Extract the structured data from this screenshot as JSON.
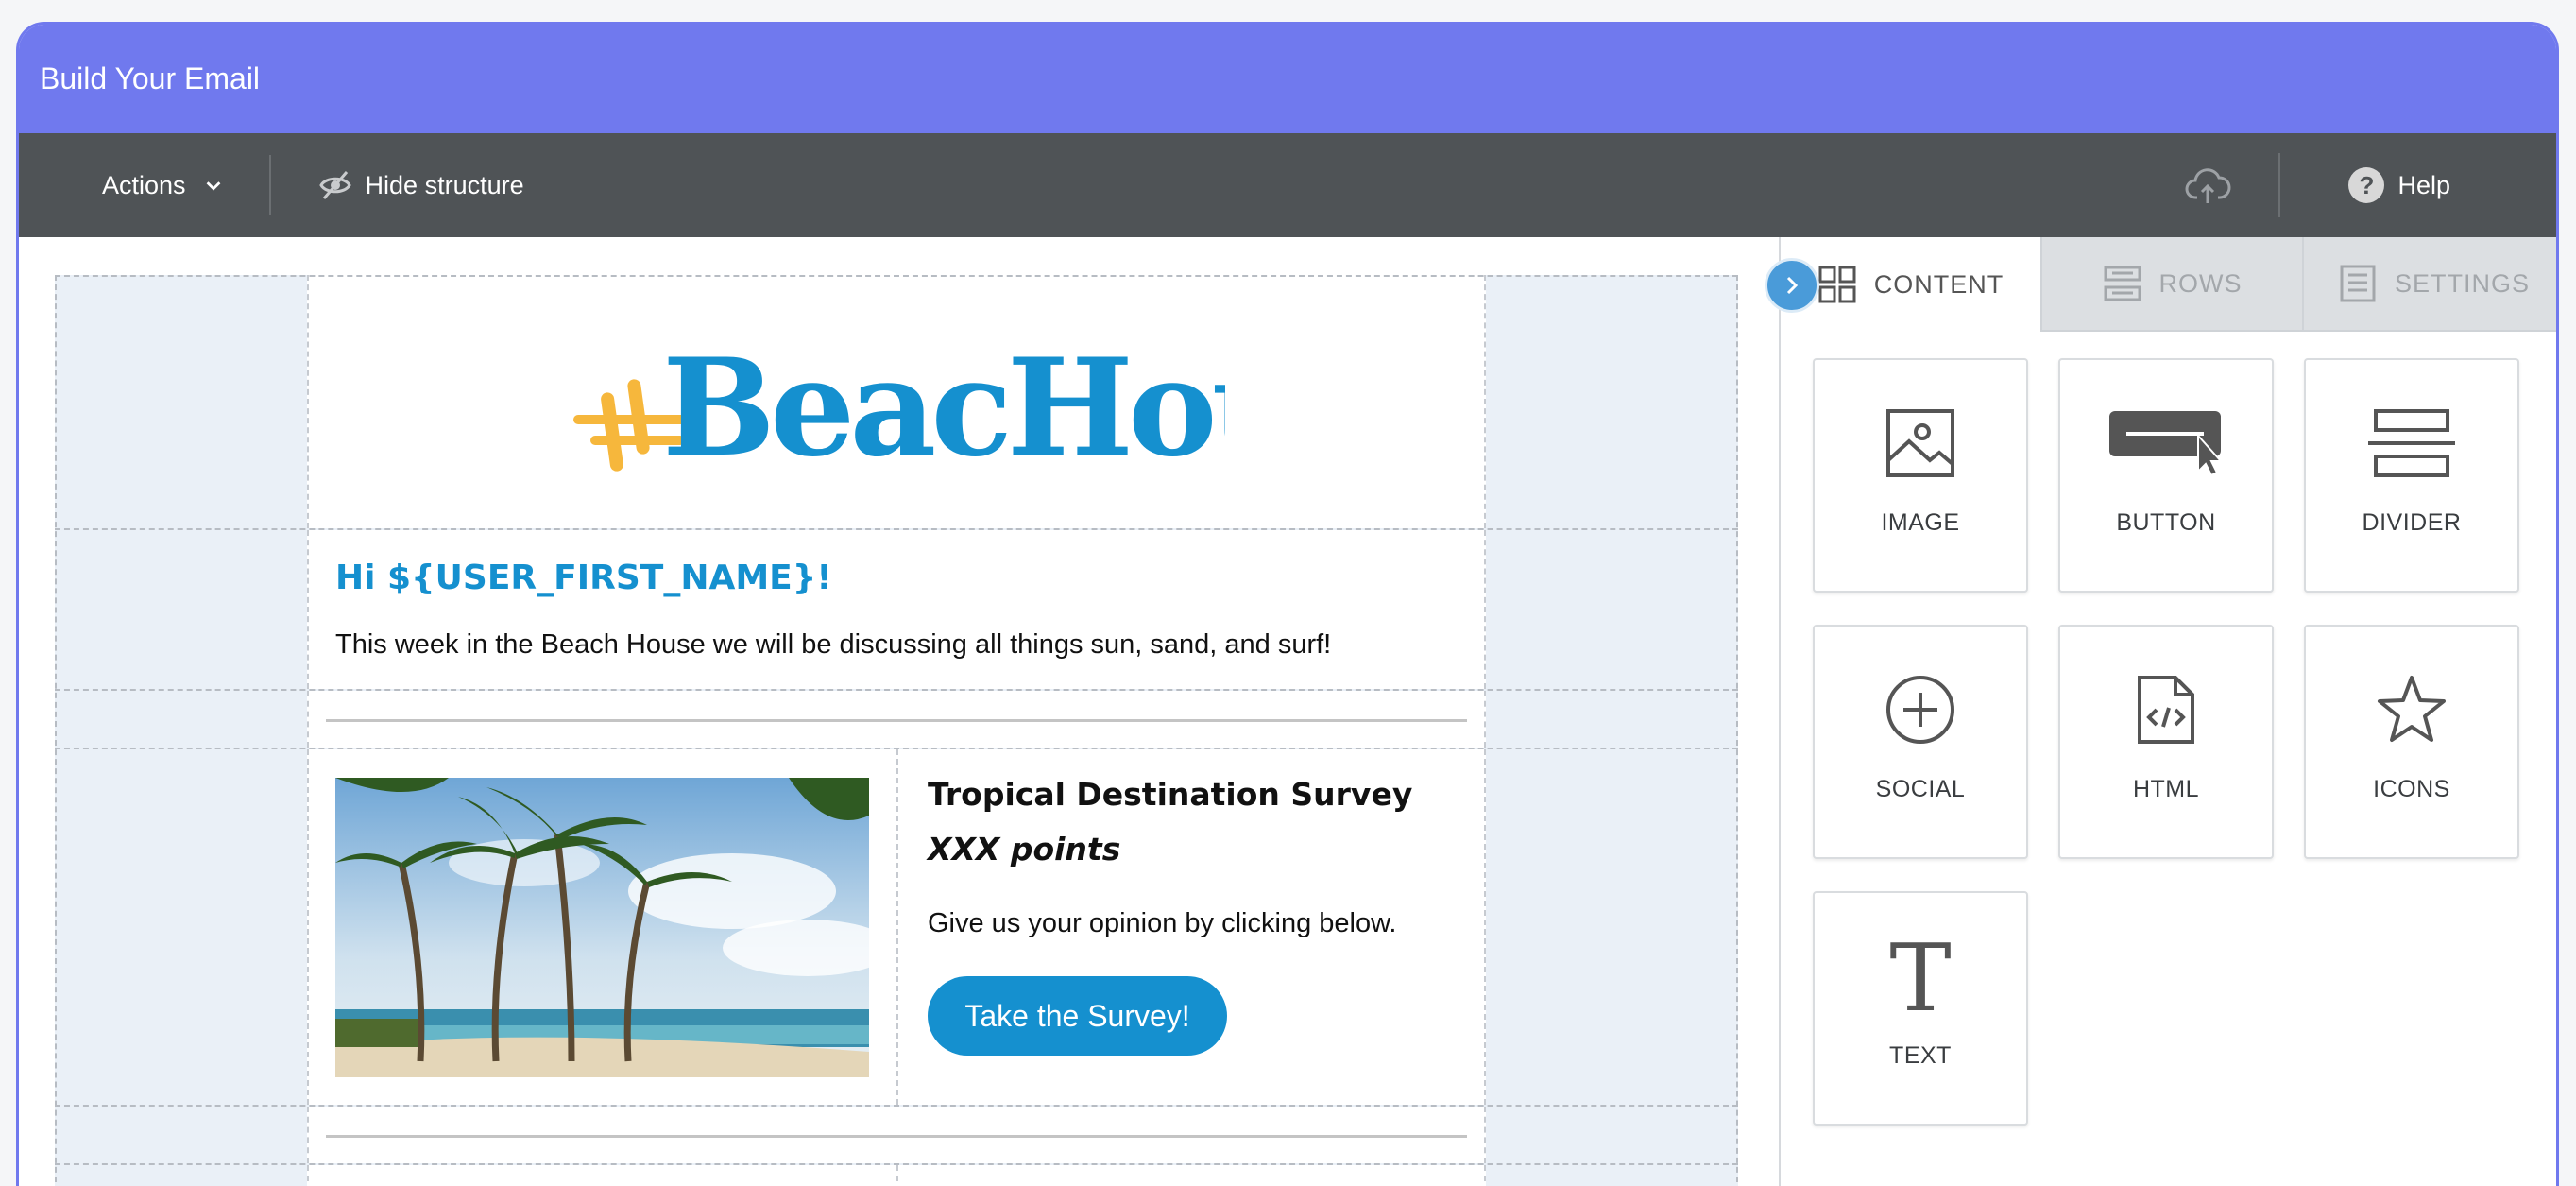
{
  "window": {
    "title": "Build Your Email"
  },
  "toolbar": {
    "actions_label": "Actions",
    "hide_structure_label": "Hide structure",
    "help_label": "Help"
  },
  "panel": {
    "tabs": [
      {
        "label": "CONTENT",
        "icon": "grid-icon",
        "active": true
      },
      {
        "label": "ROWS",
        "icon": "rows-icon",
        "active": false
      },
      {
        "label": "SETTINGS",
        "icon": "settings-icon",
        "active": false
      }
    ],
    "blocks": [
      {
        "label": "IMAGE",
        "icon": "image-icon"
      },
      {
        "label": "BUTTON",
        "icon": "button-icon"
      },
      {
        "label": "DIVIDER",
        "icon": "divider-icon"
      },
      {
        "label": "SOCIAL",
        "icon": "social-icon"
      },
      {
        "label": "HTML",
        "icon": "html-icon"
      },
      {
        "label": "ICONS",
        "icon": "star-icon"
      },
      {
        "label": "TEXT",
        "icon": "text-icon"
      }
    ]
  },
  "email": {
    "logo_text": "theBeacHouse",
    "greeting": "Hi ${USER_FIRST_NAME}!",
    "intro": "This week in the Beach House we will be discussing all things sun, sand, and surf!",
    "survey": {
      "title": "Tropical Destination Survey",
      "points": "XXX points",
      "text": "Give us your opinion by clicking below.",
      "button": "Take the Survey!"
    }
  },
  "colors": {
    "accent": "#7079ee",
    "brand_blue": "#1590cf",
    "toolbar": "#4f5356",
    "logo_yellow": "#f6b73c"
  }
}
